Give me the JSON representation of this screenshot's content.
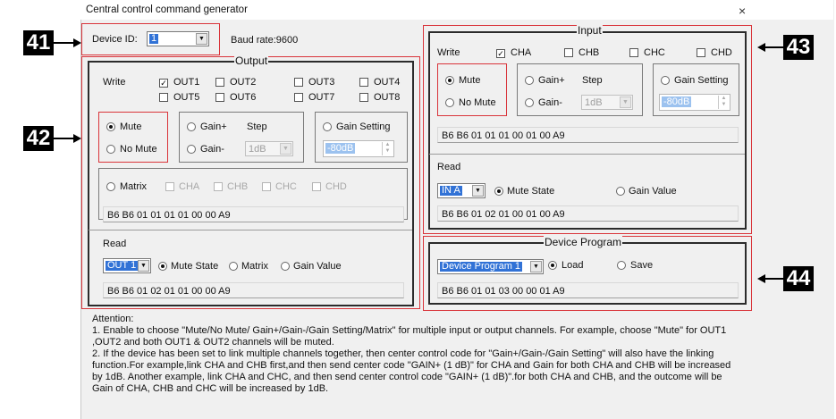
{
  "window": {
    "title": "Central control command generator",
    "close_glyph": "×"
  },
  "callouts": [
    "41",
    "42",
    "43",
    "44"
  ],
  "device": {
    "label": "Device ID:",
    "id_value": "1",
    "baud": "Baud rate:9600"
  },
  "output": {
    "legend": "Output",
    "write_label": "Write",
    "channels": [
      "OUT1",
      "OUT2",
      "OUT3",
      "OUT4",
      "OUT5",
      "OUT6",
      "OUT7",
      "OUT8"
    ],
    "checked": [
      "OUT1"
    ],
    "mute": "Mute",
    "no_mute": "No Mute",
    "gain_plus": "Gain+",
    "gain_minus": "Gain-",
    "step": "Step",
    "step_value": "1dB",
    "gain_setting": "Gain Setting",
    "gain_value": "-80dB",
    "matrix": "Matrix",
    "matrix_channels": [
      "CHA",
      "CHB",
      "CHC",
      "CHD"
    ],
    "write_code": "B6 B6 01 01 01 01 00 00 A9",
    "read_label": "Read",
    "read_select": "OUT 1",
    "read_mute": "Mute State",
    "read_matrix": "Matrix",
    "read_gain": "Gain Value",
    "read_code": "B6 B6 01 02 01 01 00 00 A9"
  },
  "input": {
    "legend": "Input",
    "write_label": "Write",
    "channels": [
      "CHA",
      "CHB",
      "CHC",
      "CHD"
    ],
    "checked": [
      "CHA"
    ],
    "mute": "Mute",
    "no_mute": "No Mute",
    "gain_plus": "Gain+",
    "gain_minus": "Gain-",
    "step": "Step",
    "step_value": "1dB",
    "gain_setting": "Gain Setting",
    "gain_value": "-80dB",
    "write_code": "B6 B6 01 01 01 00 01 00 A9",
    "read_label": "Read",
    "read_select": "IN A",
    "read_mute": "Mute State",
    "read_gain": "Gain Value",
    "read_code": "B6 B6 01 02 01 00 01 00 A9"
  },
  "program": {
    "legend": "Device Program",
    "select": "Device Program 1",
    "load": "Load",
    "save": "Save",
    "code": "B6 B6 01 01 03 00 00 01 A9"
  },
  "attention": {
    "title": "Attention:",
    "item1": "1.  Enable to choose \"Mute/No Mute/ Gain+/Gain-/Gain Setting/Matrix\" for multiple input or output channels. For example, choose \"Mute\" for OUT1 ,OUT2 and both OUT1 & OUT2 channels will be muted.",
    "item2": "2.  If the device has been set to link multiple channels together, then center control code for \"Gain+/Gain-/Gain Setting\" will also have the linking function.For example,link CHA and CHB first,and then send center code \"GAIN+ (1 dB)\" for CHA and Gain for both CHA and CHB will be increased by 1dB. Another example, link CHA and CHC, and then send center control code \"GAIN+ (1 dB)\".for both CHA and CHB, and the outcome will be Gain of CHA, CHB and CHC will be increased by 1dB."
  },
  "colors": {
    "callout_outline": "#d9343a",
    "selection": "#3172d6",
    "window_bg": "#f0f0f0"
  }
}
